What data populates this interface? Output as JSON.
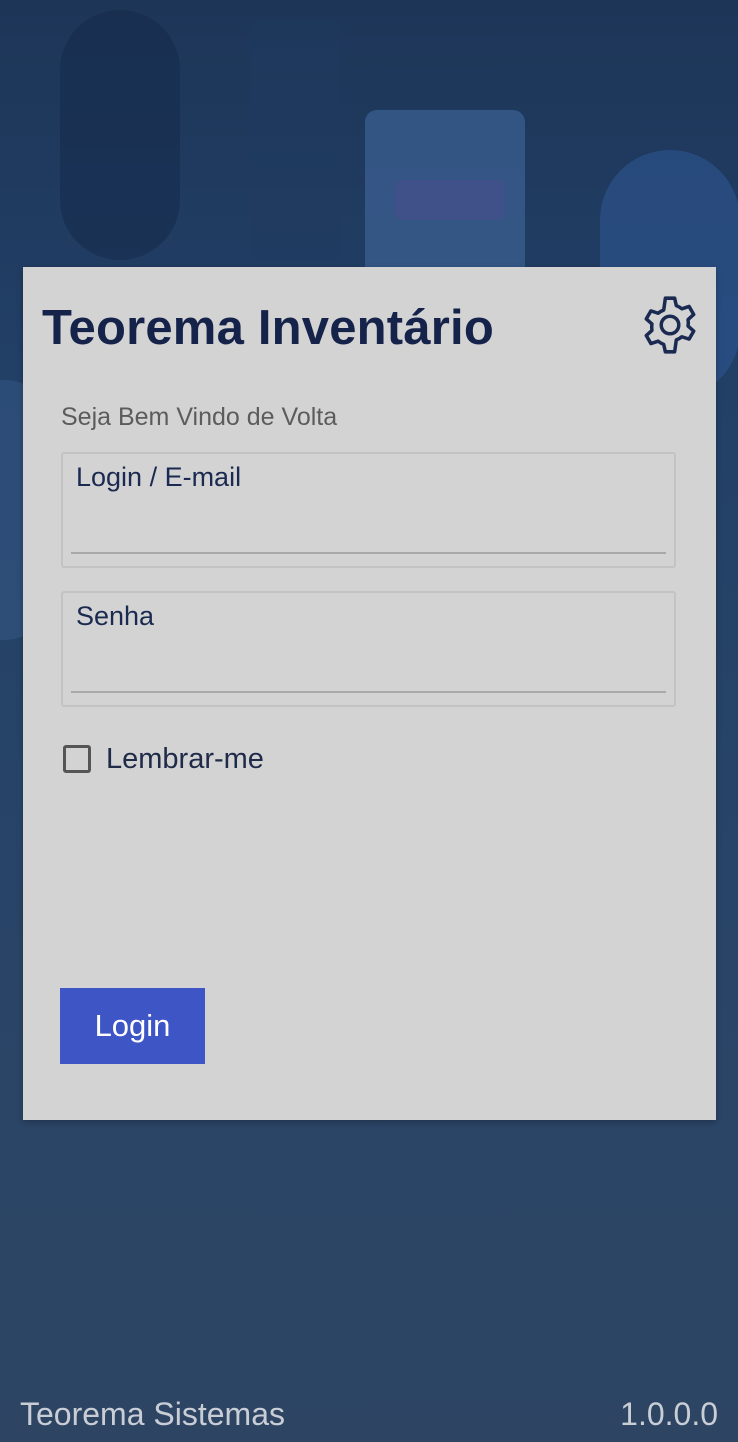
{
  "app": {
    "title": "Teorema Inventário",
    "welcome": "Seja Bem Vindo de Volta"
  },
  "form": {
    "login_label": "Login / E-mail",
    "login_value": "",
    "password_label": "Senha",
    "password_value": "",
    "remember_label": "Lembrar-me",
    "remember_checked": false,
    "submit_label": "Login"
  },
  "footer": {
    "company": "Teorema Sistemas",
    "version": "1.0.0.0"
  },
  "icons": {
    "settings": "gear-icon"
  },
  "colors": {
    "primary_button": "#3e55c6",
    "title_text": "#15224a",
    "card_background": "#d3d3d3",
    "screen_background": "#243f64"
  }
}
